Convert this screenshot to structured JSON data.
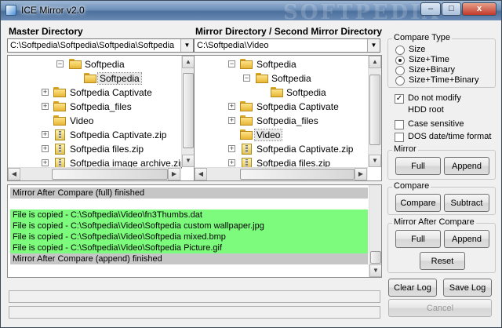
{
  "window": {
    "title": "ICE Mirror v2.0",
    "watermark": "SOFTPEDIA"
  },
  "titlebar": {
    "min": "–",
    "max": "□",
    "close": "x"
  },
  "master": {
    "label": "Master Directory",
    "path": "C:\\Softpedia\\Softpedia\\Softpedia\\Softpedia",
    "tree": [
      "Softpedia",
      "Softpedia",
      "Softpedia Captivate",
      "Softpedia_files",
      "Video",
      "Softpedia Captivate.zip",
      "Softpedia files.zip",
      "Softpedia image archive.zip"
    ]
  },
  "mirror": {
    "label": "Mirror Directory / Second Mirror Directory",
    "path": "C:\\Softpedia\\Video",
    "tree": [
      "Softpedia",
      "Softpedia",
      "Softpedia",
      "Softpedia Captivate",
      "Softpedia_files",
      "Video",
      "Softpedia Captivate.zip",
      "Softpedia files.zip"
    ]
  },
  "log": {
    "lines": [
      "Mirror After Compare (full) finished",
      "",
      "File is copied - C:\\Softpedia\\Video\\fn3Thumbs.dat",
      "File is copied - C:\\Softpedia\\Video\\Softpedia custom wallpaper.jpg",
      "File is copied - C:\\Softpedia\\Video\\Softpedia mixed.bmp",
      "File is copied - C:\\Softpedia\\Video\\Softpedia Picture.gif",
      "Mirror After Compare (append) finished"
    ]
  },
  "compare_type": {
    "title": "Compare Type",
    "options": [
      "Size",
      "Size+Time",
      "Size+Binary",
      "Size+Time+Binary"
    ],
    "selected": "Size+Time"
  },
  "checks": {
    "no_modify": "Do not modify",
    "hdd_root": "HDD root",
    "case_sensitive": "Case sensitive",
    "dos_datetime": "DOS date/time format"
  },
  "mirror_group": {
    "title": "Mirror",
    "full": "Full",
    "append": "Append"
  },
  "compare_group": {
    "title": "Compare",
    "compare": "Compare",
    "subtract": "Subtract"
  },
  "mirror_after": {
    "title": "Mirror After Compare",
    "full": "Full",
    "append": "Append",
    "reset": "Reset"
  },
  "bottom": {
    "clear_log": "Clear Log",
    "save_log": "Save Log",
    "cancel": "Cancel"
  },
  "glyphs": {
    "down": "▼",
    "up": "▲",
    "left": "◀",
    "right": "▶",
    "plus": "+",
    "minus": "−",
    "check": "✓"
  }
}
